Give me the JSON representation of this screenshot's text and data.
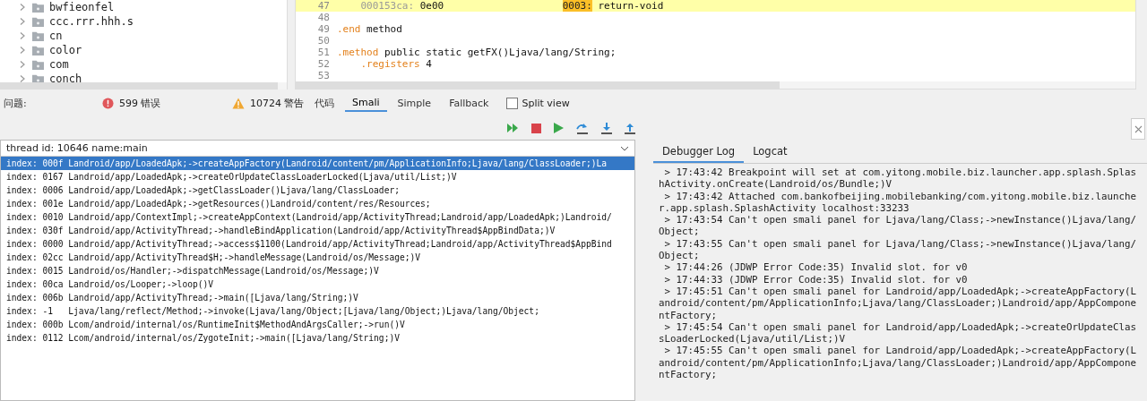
{
  "tree": {
    "items": [
      {
        "label": "bwfieonfel",
        "expanded": false
      },
      {
        "label": "ccc.rrr.hhh.s",
        "expanded": false
      },
      {
        "label": "cn",
        "expanded": false
      },
      {
        "label": "color",
        "expanded": false
      },
      {
        "label": "com",
        "expanded": false
      },
      {
        "label": "conch",
        "expanded": false
      }
    ]
  },
  "code": {
    "lines": [
      {
        "number": "47",
        "highlighted": true,
        "segments": [
          {
            "text": "    000153ca:",
            "kind": "addr"
          },
          {
            "text": " 0e00                    ",
            "kind": "plain"
          },
          {
            "text": "0003:",
            "kind": "label"
          },
          {
            "text": " return-void",
            "kind": "plain"
          }
        ]
      },
      {
        "number": "48",
        "highlighted": false
      },
      {
        "number": "49",
        "highlighted": false,
        "segments": [
          {
            "text": ".end",
            "kind": "keyword"
          },
          {
            "text": " method",
            "kind": "plain"
          }
        ]
      },
      {
        "number": "50",
        "highlighted": false
      },
      {
        "number": "51",
        "highlighted": false,
        "segments": [
          {
            "text": ".method",
            "kind": "keyword"
          },
          {
            "text": " public static getFX()Ljava/lang/String;",
            "kind": "plain"
          }
        ]
      },
      {
        "number": "52",
        "highlighted": false,
        "segments": [
          {
            "text": "    .registers",
            "kind": "keyword"
          },
          {
            "text": " 4",
            "kind": "plain"
          }
        ]
      },
      {
        "number": "53",
        "highlighted": false
      }
    ]
  },
  "status_bar": {
    "label": "问题:",
    "errors": "599 错误",
    "warnings": "10724 警告"
  },
  "tabs": [
    {
      "label": "代码",
      "selected": false
    },
    {
      "label": "Smali",
      "selected": true
    },
    {
      "label": "Simple",
      "selected": false
    },
    {
      "label": "Fallback",
      "selected": false
    }
  ],
  "split_view": {
    "label": "Split view",
    "checked": false
  },
  "thread_select": {
    "value": "thread id: 10646 name:main"
  },
  "stack_frames": [
    {
      "text": "index: 000f Landroid/app/LoadedApk;->createAppFactory(Landroid/content/pm/ApplicationInfo;Ljava/lang/ClassLoader;)La",
      "selected": true
    },
    {
      "text": "index: 0167 Landroid/app/LoadedApk;->createOrUpdateClassLoaderLocked(Ljava/util/List;)V",
      "selected": false
    },
    {
      "text": "index: 0006 Landroid/app/LoadedApk;->getClassLoader()Ljava/lang/ClassLoader;",
      "selected": false
    },
    {
      "text": "index: 001e Landroid/app/LoadedApk;->getResources()Landroid/content/res/Resources;",
      "selected": false
    },
    {
      "text": "index: 0010 Landroid/app/ContextImpl;->createAppContext(Landroid/app/ActivityThread;Landroid/app/LoadedApk;)Landroid/",
      "selected": false
    },
    {
      "text": "index: 030f Landroid/app/ActivityThread;->handleBindApplication(Landroid/app/ActivityThread$AppBindData;)V",
      "selected": false
    },
    {
      "text": "index: 0000 Landroid/app/ActivityThread;->access$1100(Landroid/app/ActivityThread;Landroid/app/ActivityThread$AppBind",
      "selected": false
    },
    {
      "text": "index: 02cc Landroid/app/ActivityThread$H;->handleMessage(Landroid/os/Message;)V",
      "selected": false
    },
    {
      "text": "index: 0015 Landroid/os/Handler;->dispatchMessage(Landroid/os/Message;)V",
      "selected": false
    },
    {
      "text": "index: 00ca Landroid/os/Looper;->loop()V",
      "selected": false
    },
    {
      "text": "index: 006b Landroid/app/ActivityThread;->main([Ljava/lang/String;)V",
      "selected": false
    },
    {
      "text": "index: -1   Ljava/lang/reflect/Method;->invoke(Ljava/lang/Object;[Ljava/lang/Object;)Ljava/lang/Object;",
      "selected": false
    },
    {
      "text": "index: 000b Lcom/android/internal/os/RuntimeInit$MethodAndArgsCaller;->run()V",
      "selected": false
    },
    {
      "text": "index: 0112 Lcom/android/internal/os/ZygoteInit;->main([Ljava/lang/String;)V",
      "selected": false
    }
  ],
  "log_tabs": [
    {
      "label": "Debugger Log",
      "selected": true
    },
    {
      "label": "Logcat",
      "selected": false
    }
  ],
  "log": [
    " > 17:43:42 Breakpoint will set at com.yitong.mobile.biz.launcher.app.splash.SplashActivity.onCreate(Landroid/os/Bundle;)V",
    " > 17:43:42 Attached com.bankofbeijing.mobilebanking/com.yitong.mobile.biz.launcher.app.splash.SplashActivity localhost:33233",
    " > 17:43:54 Can't open smali panel for Ljava/lang/Class;->newInstance()Ljava/lang/Object;",
    " > 17:43:55 Can't open smali panel for Ljava/lang/Class;->newInstance()Ljava/lang/Object;",
    " > 17:44:26 (JDWP Error Code:35) Invalid slot. for v0",
    " > 17:44:33 (JDWP Error Code:35) Invalid slot. for v0",
    " > 17:45:51 Can't open smali panel for Landroid/app/LoadedApk;->createAppFactory(Landroid/content/pm/ApplicationInfo;Ljava/lang/ClassLoader;)Landroid/app/AppComponentFactory;",
    " > 17:45:54 Can't open smali panel for Landroid/app/LoadedApk;->createOrUpdateClassLoaderLocked(Ljava/util/List;)V",
    " > 17:45:55 Can't open smali panel for Landroid/app/LoadedApk;->createAppFactory(Landroid/content/pm/ApplicationInfo;Ljava/lang/ClassLoader;)Landroid/app/AppComponentFactory;"
  ]
}
